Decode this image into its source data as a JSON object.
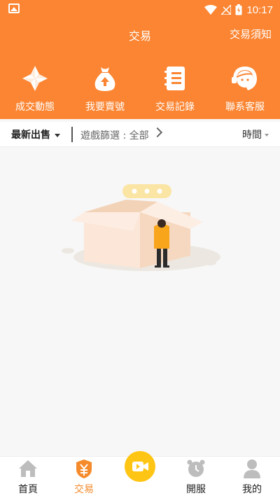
{
  "statusbar": {
    "time": "10:17"
  },
  "header": {
    "title": "交易",
    "notice_link": "交易須知"
  },
  "actions": [
    {
      "label": "成交動態",
      "icon": "pinwheel-icon"
    },
    {
      "label": "我要賣號",
      "icon": "money-bag-icon"
    },
    {
      "label": "交易記錄",
      "icon": "notebook-icon"
    },
    {
      "label": "聯系客服",
      "icon": "customer-service-icon"
    }
  ],
  "filters": {
    "latest": "最新出售",
    "game": "遊戲篩選 : 全部",
    "time": "時間"
  },
  "tabs": [
    {
      "label": "首頁",
      "icon": "home-icon"
    },
    {
      "label": "交易",
      "icon": "trade-shield-icon",
      "active": true
    },
    {
      "label": "",
      "icon": "video-icon"
    },
    {
      "label": "開服",
      "icon": "alarm-clock-icon"
    },
    {
      "label": "我的",
      "icon": "person-icon"
    }
  ],
  "colors": {
    "brand": "#fb8532",
    "active_tab": "#f58a2b",
    "background": "#f7f7f7"
  }
}
